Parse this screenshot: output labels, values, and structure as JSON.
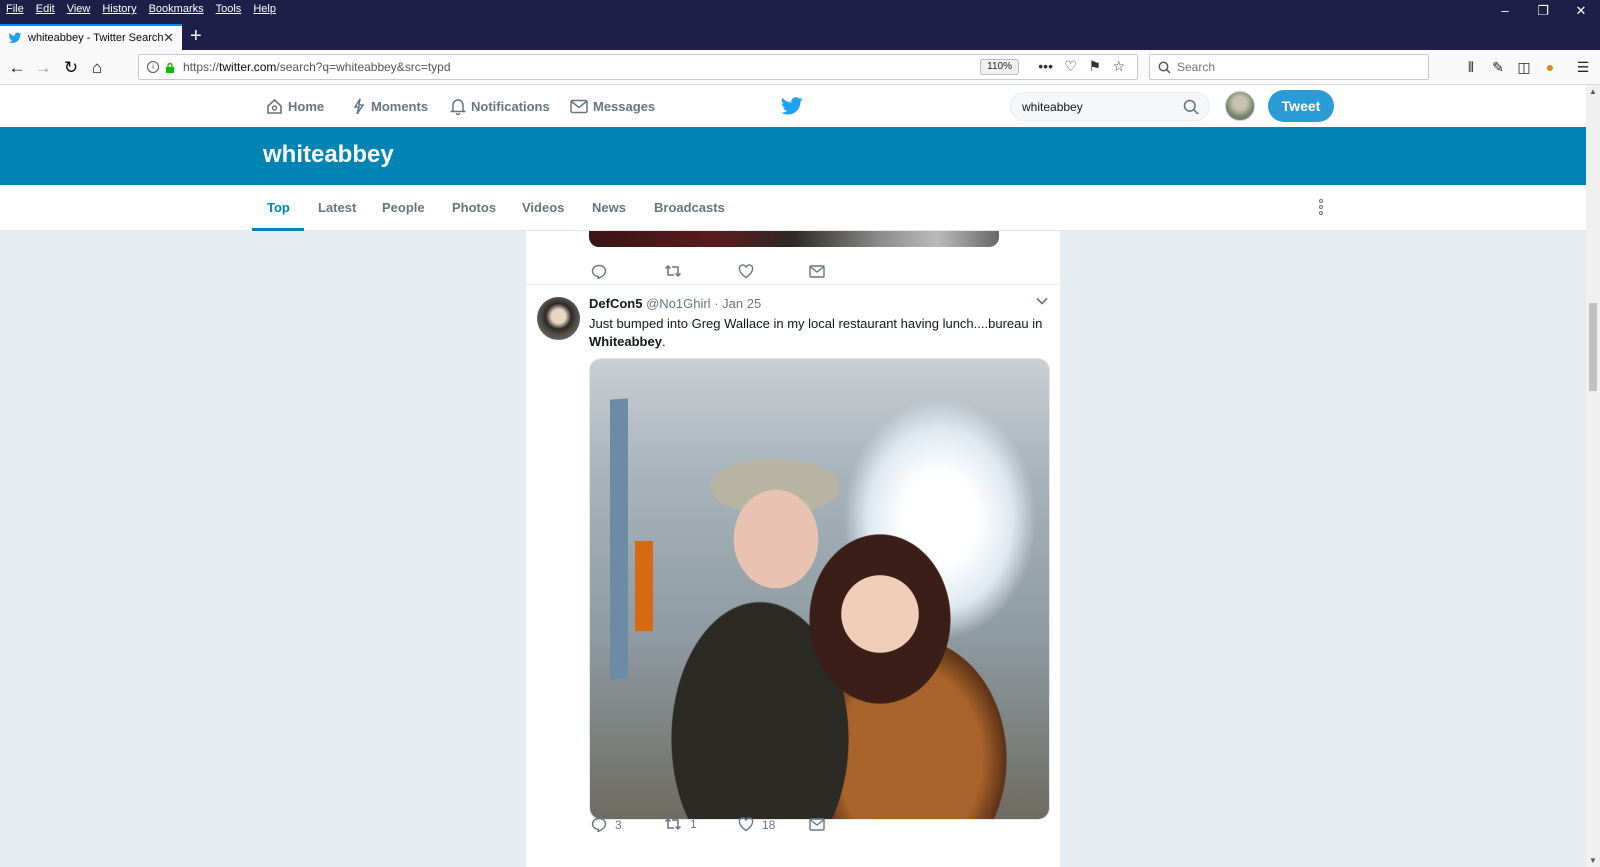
{
  "browser": {
    "menu": [
      "File",
      "Edit",
      "View",
      "History",
      "Bookmarks",
      "Tools",
      "Help"
    ],
    "tab_title": "whiteabbey - Twitter Search",
    "url_prefix": "https://",
    "url_host": "twitter.com",
    "url_path": "/search?q=whiteabbey&src=typd",
    "zoom": "110%",
    "search_placeholder": "Search"
  },
  "twitter": {
    "nav": {
      "home": "Home",
      "moments": "Moments",
      "notifications": "Notifications",
      "messages": "Messages"
    },
    "search_value": "whiteabbey",
    "tweet_button": "Tweet",
    "query_title": "whiteabbey",
    "tabs": [
      "Top",
      "Latest",
      "People",
      "Photos",
      "Videos",
      "News",
      "Broadcasts"
    ],
    "active_tab": "Top",
    "tweet": {
      "fullname": "DefCon5",
      "username": "@No1Ghirl",
      "date": "· Jan 25",
      "text": "Just bumped into Greg Wallace in my local restaurant having lunch....bureau in",
      "highlight": "Whiteabbey",
      "text_end": ".",
      "replies": "3",
      "retweets": "1",
      "likes": "18"
    },
    "colors": {
      "accent": "#0084b4",
      "tweet_button": "#2b9bd6",
      "muted": "#66757f"
    }
  }
}
